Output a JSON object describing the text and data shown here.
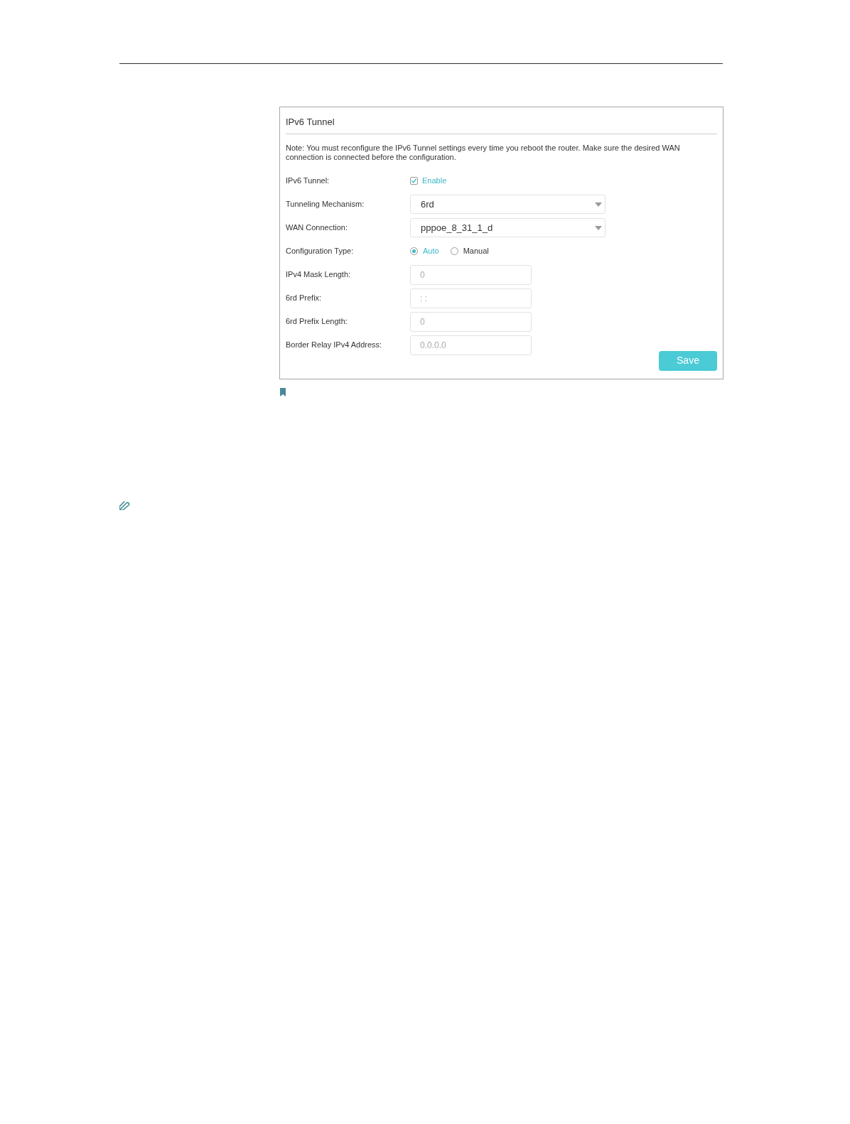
{
  "panel": {
    "title": "IPv6 Tunnel",
    "note": "Note: You must reconfigure the IPv6 Tunnel settings every time you reboot the router. Make sure the desired WAN connection is connected before the configuration.",
    "rows": [
      {
        "kind": "checkbox",
        "label": "IPv6 Tunnel:",
        "option": "Enable",
        "checked": true
      },
      {
        "kind": "select",
        "label": "Tunneling Mechanism:",
        "value": "6rd"
      },
      {
        "kind": "select",
        "label": "WAN Connection:",
        "value": "pppoe_8_31_1_d"
      },
      {
        "kind": "radio",
        "label": "Configuration Type:",
        "options": [
          {
            "label": "Auto",
            "selected": true
          },
          {
            "label": "Manual",
            "selected": false
          }
        ]
      },
      {
        "kind": "input",
        "label": "IPv4 Mask Length:",
        "placeholder": "0"
      },
      {
        "kind": "input",
        "label": "6rd Prefix:",
        "placeholder": ": :"
      },
      {
        "kind": "input",
        "label": "6rd Prefix Length:",
        "placeholder": "0"
      },
      {
        "kind": "input",
        "label": "Border Relay IPv4 Address:",
        "placeholder": "0.0.0.0"
      }
    ],
    "save_button": "Save"
  }
}
